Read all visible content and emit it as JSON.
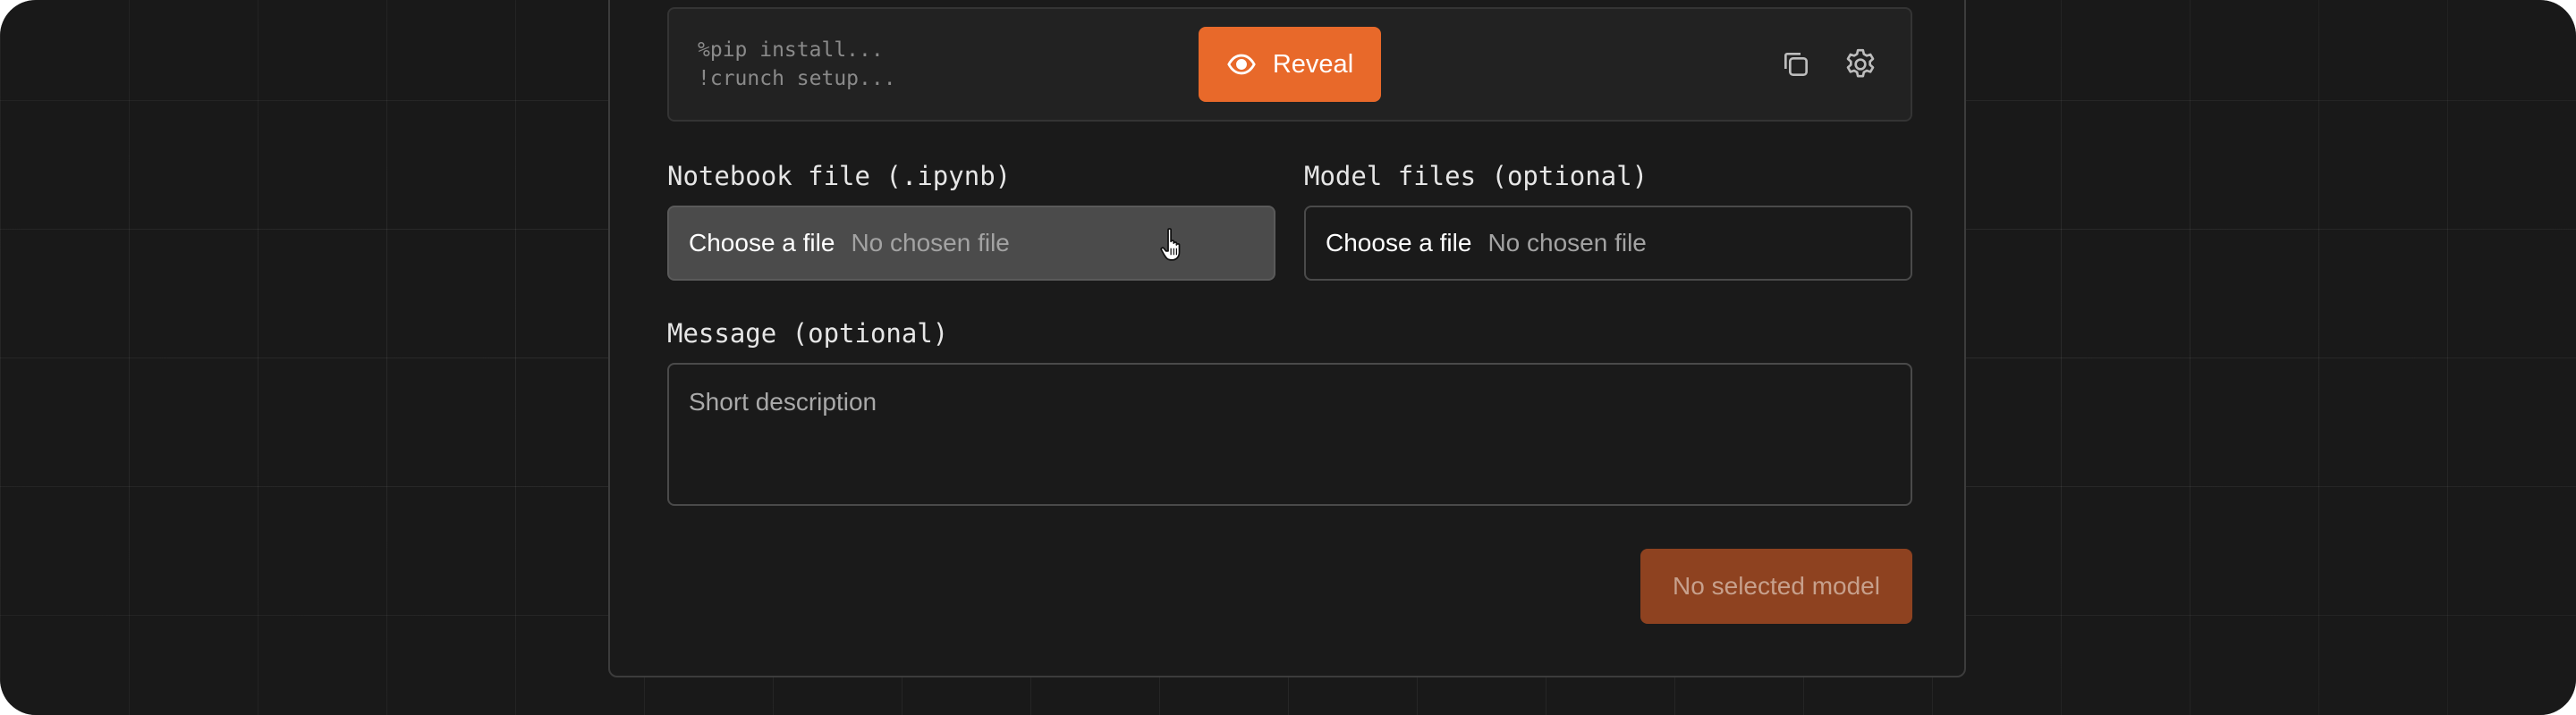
{
  "code_snippet": {
    "lines": [
      "%pip install...",
      "!crunch setup..."
    ]
  },
  "reveal_button": {
    "label": "Reveal",
    "color": "#e8692a"
  },
  "icons": {
    "reveal": "eye-icon",
    "copy": "copy-icon",
    "settings": "gear-icon",
    "pointer": "hand-cursor-icon"
  },
  "notebook_field": {
    "label": "Notebook file (.ipynb)",
    "choose_label": "Choose a file",
    "status": "No chosen file"
  },
  "model_field": {
    "label": "Model files (optional)",
    "choose_label": "Choose a file",
    "status": "No chosen file"
  },
  "message_field": {
    "label": "Message (optional)",
    "placeholder": "Short description"
  },
  "submit_button": {
    "label": "No selected model",
    "color": "#8e4220"
  }
}
